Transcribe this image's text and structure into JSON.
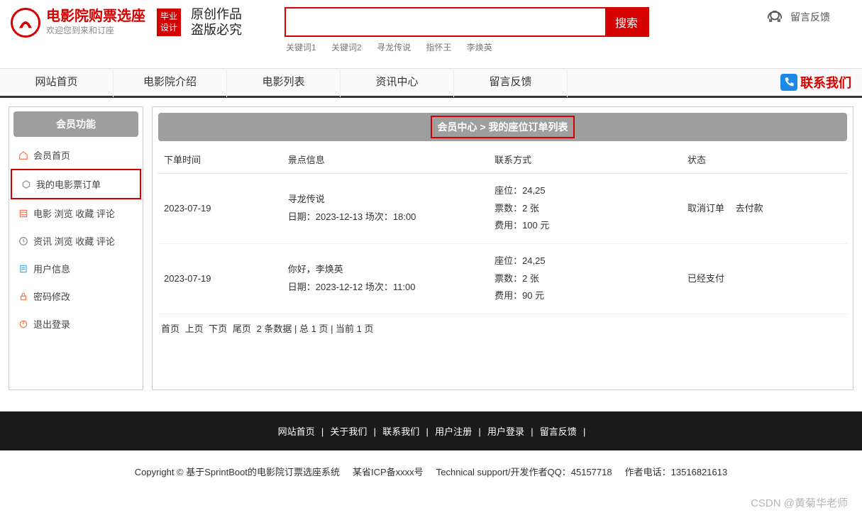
{
  "header": {
    "site_title": "电影院购票选座",
    "site_subtitle": "欢迎您到来和订座",
    "badge_line1": "毕业",
    "badge_line2": "设计",
    "calligraphy_line1": "原创作品",
    "calligraphy_line2": "盗版必究",
    "search_placeholder": "",
    "search_button": "搜索",
    "hot_keywords": [
      "关键词1",
      "关键词2",
      "寻龙传说",
      "指怀王",
      "李焕英"
    ],
    "feedback_label": "留言反馈"
  },
  "nav": {
    "items": [
      "网站首页",
      "电影院介绍",
      "电影列表",
      "资讯中心",
      "留言反馈"
    ],
    "contact_label": "联系我们"
  },
  "sidebar": {
    "title": "会员功能",
    "items": [
      {
        "icon": "home",
        "label": "会员首页"
      },
      {
        "icon": "cart",
        "label": "我的电影票订单",
        "active": true
      },
      {
        "icon": "film",
        "label": "电影 浏览 收藏 评论"
      },
      {
        "icon": "clock",
        "label": "资讯 浏览 收藏 评论"
      },
      {
        "icon": "user",
        "label": "用户信息"
      },
      {
        "icon": "lock",
        "label": "密码修改"
      },
      {
        "icon": "power",
        "label": "退出登录"
      }
    ]
  },
  "breadcrumb": {
    "text": "会员中心 > 我的座位订单列表"
  },
  "table": {
    "columns": [
      "下单时间",
      "景点信息",
      "联系方式",
      "状态"
    ],
    "rows": [
      {
        "order_time": "2023-07-19",
        "spot_title": "寻龙传说",
        "spot_detail": "日期：2023-12-13 场次：18:00",
        "seat": "座位：24,25",
        "count": "票数：2 张",
        "fee": "费用：100 元",
        "status_actions": [
          "取消订单",
          "去付款"
        ],
        "status_text": ""
      },
      {
        "order_time": "2023-07-19",
        "spot_title": "你好，李焕英",
        "spot_detail": "日期：2023-12-12 场次：11:00",
        "seat": "座位：24,25",
        "count": "票数：2 张",
        "fee": "费用：90 元",
        "status_actions": [],
        "status_text": "已经支付"
      }
    ]
  },
  "pagination": {
    "links": [
      "首页",
      "上页",
      "下页",
      "尾页"
    ],
    "summary": "2 条数据 | 总 1 页 | 当前 1 页"
  },
  "footer": {
    "dark_links": [
      "网站首页",
      "关于我们",
      "联系我们",
      "用户注册",
      "用户登录",
      "留言反馈"
    ],
    "copyright": "Copyright © 基于SprintBoot的电影院订票选座系统",
    "icp": "某省ICP备xxxx号",
    "support": "Technical support/开发作者QQ：45157718",
    "phone": "作者电话：13516821613"
  },
  "watermark": "CSDN @黄菊华老师"
}
